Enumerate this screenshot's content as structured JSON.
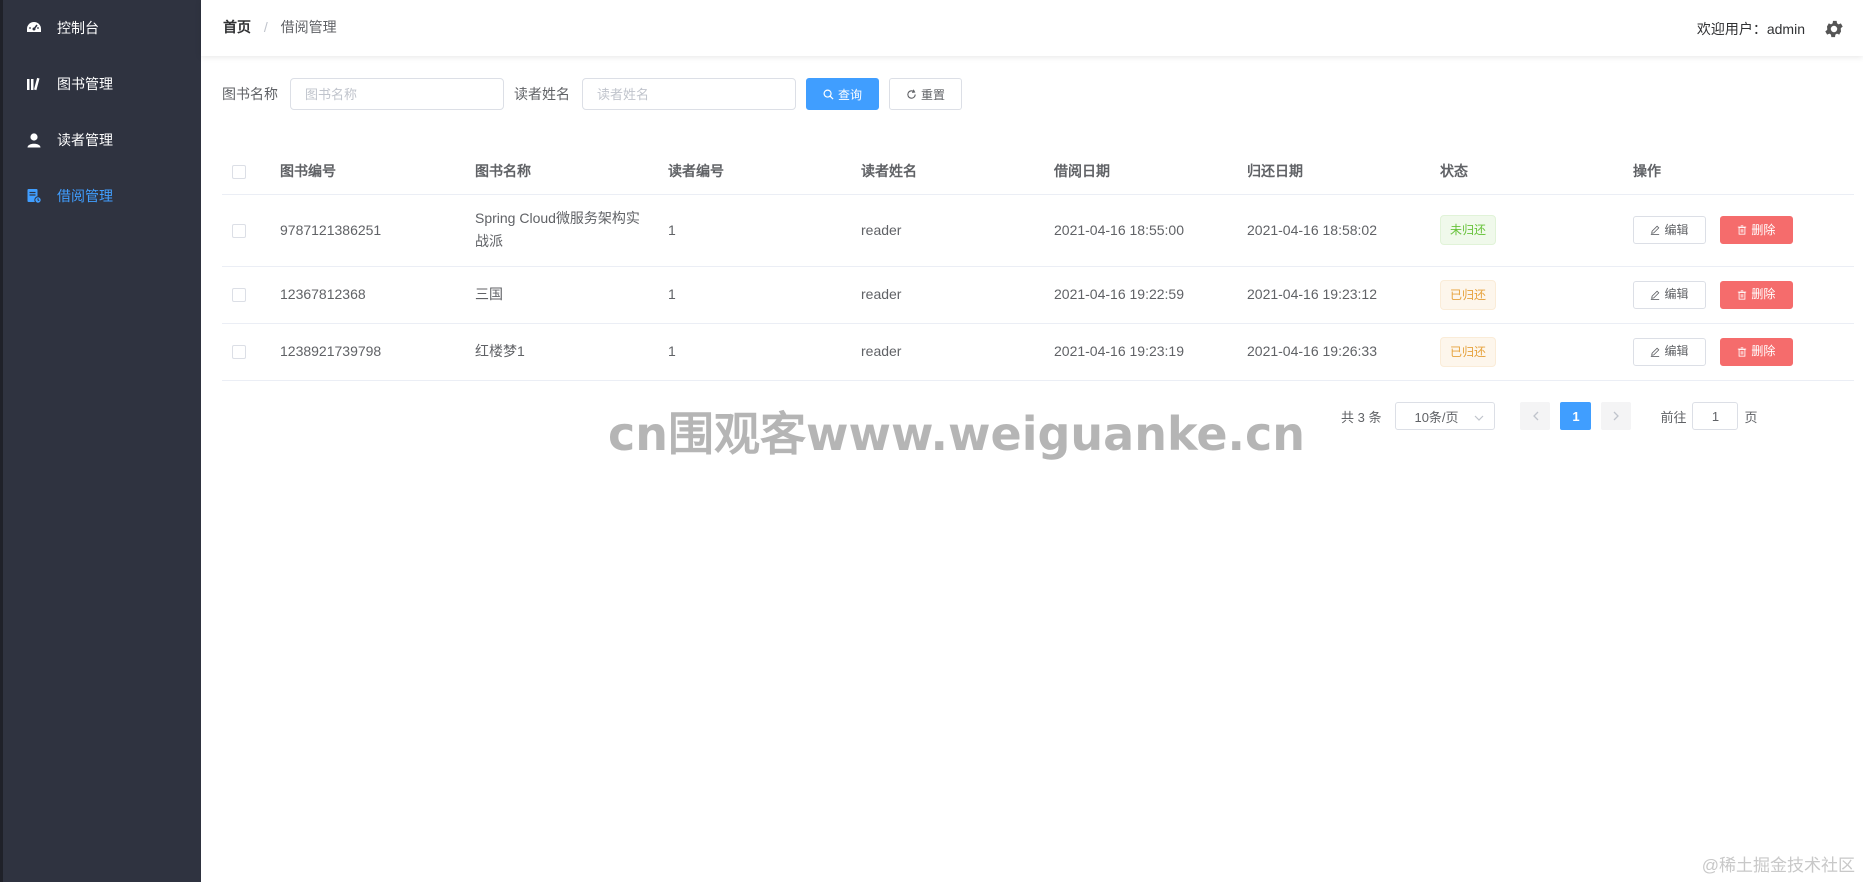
{
  "sidebar": {
    "items": [
      {
        "label": "控制台",
        "icon": "dashboard-icon",
        "active": false
      },
      {
        "label": "图书管理",
        "icon": "books-icon",
        "active": false
      },
      {
        "label": "读者管理",
        "icon": "user-icon",
        "active": false
      },
      {
        "label": "借阅管理",
        "icon": "document-icon",
        "active": true
      }
    ]
  },
  "header": {
    "breadcrumb": {
      "home": "首页",
      "separator": "/",
      "current": "借阅管理"
    },
    "welcome": "欢迎用户：admin",
    "settings_icon": "gear-icon"
  },
  "search": {
    "book_name_label": "图书名称",
    "book_name_placeholder": "图书名称",
    "book_name_value": "",
    "reader_name_label": "读者姓名",
    "reader_name_placeholder": "读者姓名",
    "reader_name_value": "",
    "query_label": "查询",
    "reset_label": "重置"
  },
  "table": {
    "columns": [
      "图书编号",
      "图书名称",
      "读者编号",
      "读者姓名",
      "借阅日期",
      "归还日期",
      "状态",
      "操作"
    ],
    "rows": [
      {
        "book_id": "9787121386251",
        "book_name": "Spring Cloud微服务架构实战派",
        "reader_id": "1",
        "reader_name": "reader",
        "borrow_date": "2021-04-16 18:55:00",
        "return_date": "2021-04-16 18:58:02",
        "status": "未归还",
        "status_type": "not-returned"
      },
      {
        "book_id": "12367812368",
        "book_name": "三国",
        "reader_id": "1",
        "reader_name": "reader",
        "borrow_date": "2021-04-16 19:22:59",
        "return_date": "2021-04-16 19:23:12",
        "status": "已归还",
        "status_type": "returned"
      },
      {
        "book_id": "1238921739798",
        "book_name": "红楼梦1",
        "reader_id": "1",
        "reader_name": "reader",
        "borrow_date": "2021-04-16 19:23:19",
        "return_date": "2021-04-16 19:26:33",
        "status": "已归还",
        "status_type": "returned"
      }
    ],
    "edit_label": "编辑",
    "delete_label": "删除"
  },
  "pagination": {
    "total": "共 3 条",
    "page_size": "10条/页",
    "current_page": "1",
    "goto_label": "前往",
    "goto_value": "1",
    "page_unit": "页"
  },
  "watermark": "cn围观客www.weiguanke.cn",
  "corner_mark": "@稀土掘金技术社区",
  "colors": {
    "sidebar_bg": "#2f3340",
    "primary": "#409eff",
    "danger": "#f56c6c",
    "success": "#67c23a",
    "warning": "#e6a23c"
  }
}
